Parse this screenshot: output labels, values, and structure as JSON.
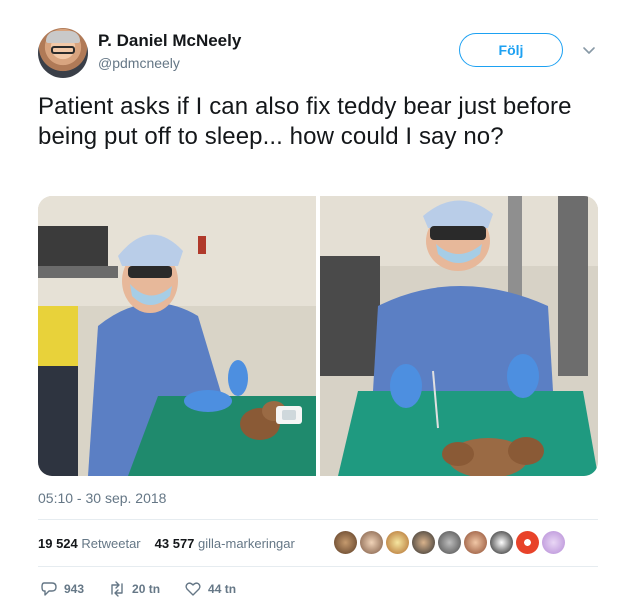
{
  "author": {
    "name": "P. Daniel McNeely",
    "handle": "@pdmcneely"
  },
  "follow_label": "Följ",
  "tweet_text": "Patient asks if I can also fix teddy bear just before being put off to sleep... how could I say no?",
  "timestamp": "05:10 - 30 sep. 2018",
  "stats": {
    "retweets_count": "19 524",
    "retweets_label": "Retweetar",
    "likes_count": "43 577",
    "likes_label": "gilla-markeringar"
  },
  "actions": {
    "replies": "943",
    "retweets": "20 tn",
    "likes": "44 tn"
  },
  "colors": {
    "accent": "#1da1f2",
    "text": "#14171a",
    "muted": "#657786",
    "divider": "#e6ecf0"
  },
  "icons": [
    "chevron-down-icon",
    "reply-icon",
    "retweet-icon",
    "heart-icon"
  ]
}
